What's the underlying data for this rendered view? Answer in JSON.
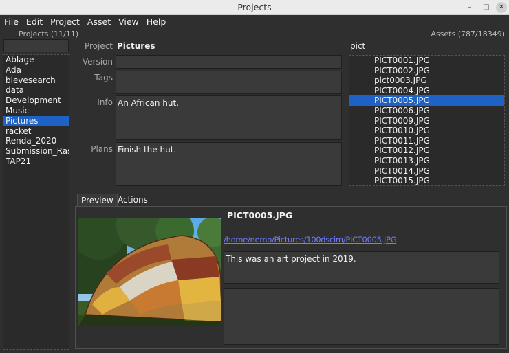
{
  "window": {
    "title": "Projects"
  },
  "menu": [
    "File",
    "Edit",
    "Project",
    "Asset",
    "View",
    "Help"
  ],
  "projects_header": "Projects (11/11)",
  "assets_header": "Assets (787/18349)",
  "project_filter": "",
  "asset_filter": "pict",
  "projects": [
    "Ablage",
    "Ada",
    "blevesearch",
    "data",
    "Development",
    "Music",
    "Pictures",
    "racket",
    "Renda_2020",
    "Submission_Rast_E",
    "TAP21"
  ],
  "selected_project": "Pictures",
  "form": {
    "project_label": "Project",
    "project_value": "Pictures",
    "version_label": "Version",
    "version_value": "",
    "tags_label": "Tags",
    "tags_value": "",
    "info_label": "Info",
    "info_value": "An African hut.",
    "plans_label": "Plans",
    "plans_value": "Finish the hut."
  },
  "assets": [
    "PICT0001.JPG",
    "PICT0002.JPG",
    "pict0003.JPG",
    "PICT0004.JPG",
    "PICT0005.JPG",
    "PICT0006.JPG",
    "PICT0009.JPG",
    "PICT0010.JPG",
    "PICT0011.JPG",
    "PICT0012.JPG",
    "PICT0013.JPG",
    "PICT0014.JPG",
    "PICT0015.JPG"
  ],
  "selected_asset": "PICT0005.JPG",
  "tabs": {
    "preview": "Preview",
    "actions": "Actions"
  },
  "preview": {
    "filename": "PICT0005.JPG",
    "path": "/home/nemo/Pictures/100dscim/PICT0005.JPG",
    "note": "This was an art project in 2019.",
    "note2": ""
  },
  "icons": {
    "minimize": "minimize-icon",
    "maximize": "maximize-icon",
    "close": "close-icon"
  },
  "colors": {
    "selection": "#1e62c6",
    "link": "#6f7dff"
  }
}
